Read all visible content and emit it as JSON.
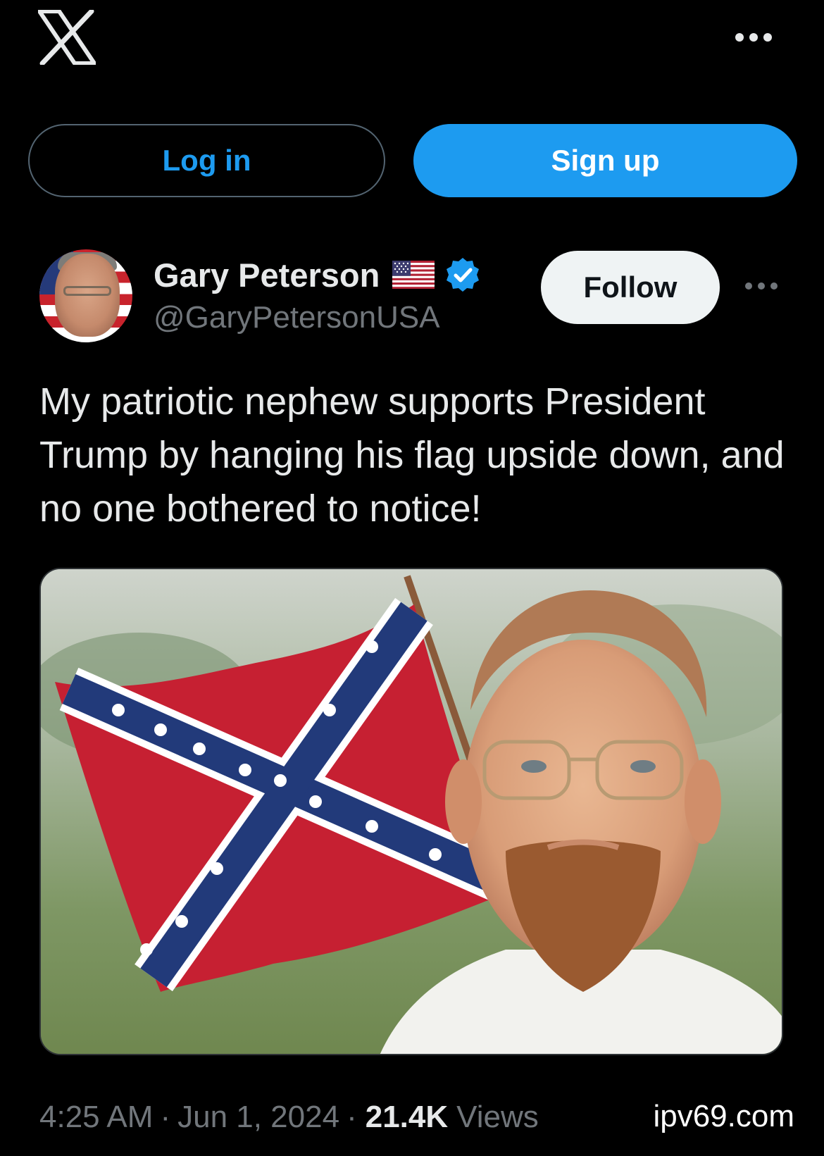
{
  "top_bar": {
    "logo_icon": "x-logo-icon",
    "more_icon": "more-horizontal-icon"
  },
  "auth": {
    "login_label": "Log in",
    "signup_label": "Sign up"
  },
  "post": {
    "author": {
      "display_name": "Gary Peterson",
      "handle": "@GaryPetersonUSA",
      "flag_emoji_icon": "us-flag-emoji-icon",
      "verified_icon": "verified-badge-icon",
      "follow_label": "Follow"
    },
    "text": "My patriotic nephew supports President Trump by hanging his flag upside down, and no one bothered to notice!",
    "media": {
      "kind": "photo"
    },
    "meta": {
      "time": "4:25 AM",
      "separator": "·",
      "date": "Jun 1, 2024",
      "views_count": "21.4K",
      "views_label": "Views"
    },
    "watermark": "ipv69.com"
  },
  "colors": {
    "background": "#000000",
    "accent": "#1d9bf0",
    "primary_text": "#e7e9ea",
    "secondary_text": "#71767b",
    "follow_bg": "#eff3f4"
  }
}
